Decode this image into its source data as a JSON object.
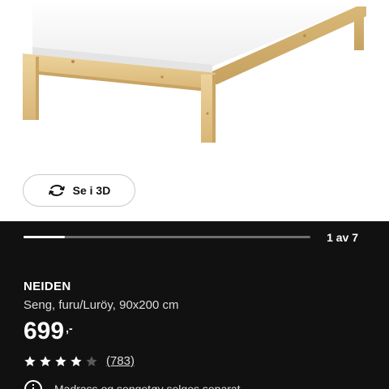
{
  "media": {
    "image_alt": "NEIDEN bed frame, pine",
    "view_3d_label": "Se i 3D",
    "view_3d_icon": "rotate-3d-icon"
  },
  "gallery": {
    "current": 1,
    "total": 7,
    "counter_text": "1 av 7",
    "progress_fraction": 0.143
  },
  "product": {
    "name": "NEIDEN",
    "description": "Seng, furu/Luröy, 90x200 cm",
    "price_integer": "699",
    "price_suffix": ",-",
    "rating_stars": 4,
    "rating_max": 5,
    "rating_count_text": "(783)",
    "notice_icon": "info-icon",
    "notice_text": "Madrass og sengetøy selges separat"
  },
  "colors": {
    "info_background": "#111111",
    "text_primary": "#ffffff",
    "text_secondary": "#dcdcdc",
    "star_empty": "#5a5a5a",
    "wood": "#e3c58a"
  }
}
